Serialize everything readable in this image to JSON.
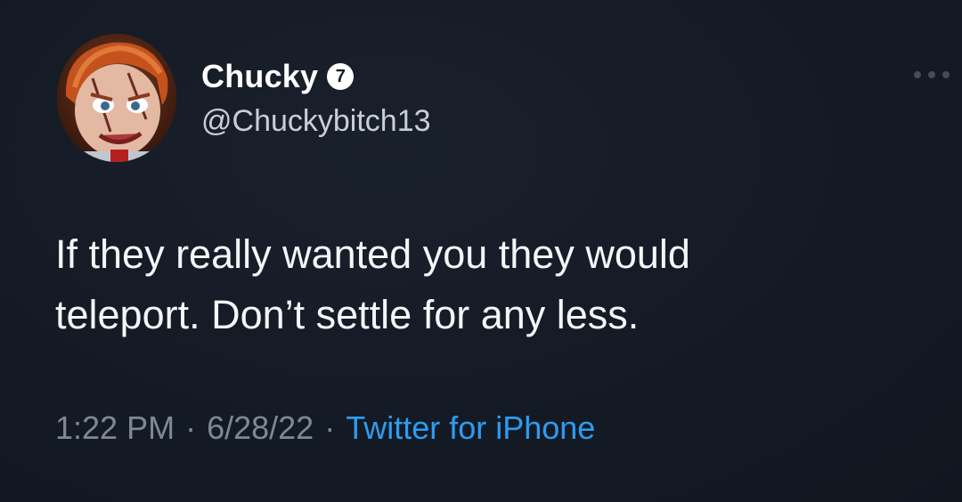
{
  "tweet": {
    "author": {
      "display_name": "Chucky",
      "badge_text": "7",
      "handle": "@Chuckybitch13",
      "avatar_icon": "chucky-doll-avatar"
    },
    "more_icon": "more-dots-icon",
    "text_line_1": "If they really wanted you they would",
    "text_line_2": "teleport. Don’t settle for any less.",
    "meta": {
      "time": "1:22 PM",
      "separator": "·",
      "date": "6/28/22",
      "source": "Twitter for iPhone"
    },
    "colors": {
      "background": "#141a24",
      "text": "#f4f5f7",
      "muted": "#7f8895",
      "link": "#2e9cf0"
    }
  }
}
